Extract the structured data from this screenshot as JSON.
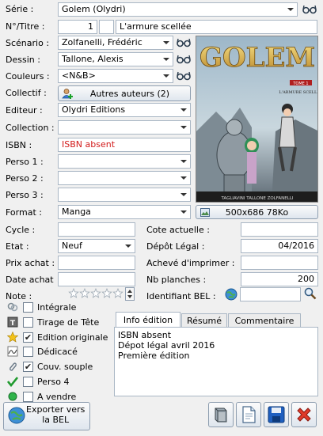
{
  "form": {
    "serie_label": "Série :",
    "serie_value": "Golem (Olydri)",
    "numtitre_label": "N°/Titre :",
    "num_value": "1",
    "titre_value": "L'armure scellée",
    "scenario_label": "Scénario :",
    "scenario_value": "Zolfanelli, Frédéric",
    "dessin_label": "Dessin :",
    "dessin_value": "Tallone, Alexis",
    "couleurs_label": "Couleurs :",
    "couleurs_value": "<N&B>",
    "collectif_label": "Collectif :",
    "autres_auteurs_label": "Autres auteurs (2)",
    "editeur_label": "Editeur :",
    "editeur_value": "Olydri Editions",
    "collection_label": "Collection :",
    "collection_value": "",
    "isbn_label": "ISBN :",
    "isbn_value": "ISBN absent",
    "perso1_label": "Perso 1 :",
    "perso2_label": "Perso 2 :",
    "perso3_label": "Perso 3 :",
    "format_label": "Format :",
    "format_value": "Manga",
    "cycle_label": "Cycle :",
    "cycle_value": "",
    "etat_label": "Etat :",
    "etat_value": "Neuf",
    "prix_label": "Prix achat :",
    "date_label": "Date achat",
    "note_label": "Note :",
    "cote_label": "Cote actuelle :",
    "depot_label": "Dépôt Légal :",
    "depot_value": "04/2016",
    "acheve_label": "Achevé d'imprimer :",
    "planches_label": "Nb planches :",
    "planches_value": "200",
    "identifiant_label": "Identifiant BEL :",
    "note_stars": 0,
    "note_max": 5
  },
  "cover": {
    "title_text": "GOLEM",
    "tome_text": "TOME 1",
    "subtitle_text": "L'ARMURE SCELLÉE",
    "authors_text": "TAGLIAVINI  TALLONE  ZOLFANELLI",
    "size_label": "500x686 78Ko"
  },
  "checks": [
    {
      "label": "Intégrale",
      "checked": false,
      "icon": "rings-icon"
    },
    {
      "label": "Tirage de Tête",
      "checked": false,
      "icon": "tirage-icon"
    },
    {
      "label": "Edition originale",
      "checked": true,
      "icon": "star-icon"
    },
    {
      "label": "Dédicacé",
      "checked": false,
      "icon": "signature-icon"
    },
    {
      "label": "Couv. souple",
      "checked": true,
      "icon": "paperclip-icon"
    },
    {
      "label": "Perso 4",
      "checked": false,
      "icon": "green-check-icon"
    },
    {
      "label": "A vendre",
      "checked": false,
      "icon": "green-dot-icon"
    }
  ],
  "tabs": [
    "Info édition",
    "Résumé",
    "Commentaire"
  ],
  "info_edition_lines": [
    "ISBN absent",
    "Dépot légal avril 2016",
    "Première édition"
  ],
  "export_label": "Exporter vers\nla BEL",
  "colors": {
    "isbn_absent": "#d21a1a",
    "window_bg": "#f0f0f0",
    "accent_blue": "#1f5fbf"
  }
}
